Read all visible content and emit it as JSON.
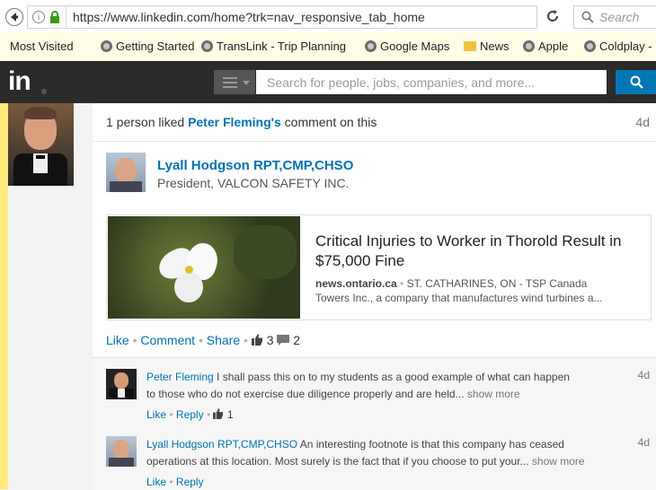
{
  "browser": {
    "url": "https://www.linkedin.com/home?trk=nav_responsive_tab_home",
    "search_placeholder": "Search",
    "bookmarks": [
      "Most Visited",
      "Getting Started",
      "TransLink - Trip Planning",
      "Google Maps",
      "News",
      "Apple",
      "Coldplay -"
    ]
  },
  "linkedin": {
    "logo": "in",
    "search_placeholder": "Search for people, jobs, companies, and more..."
  },
  "feed": {
    "activity_text_pre": "1 person liked",
    "activity_person": "Peter Fleming's",
    "activity_text_post": "comment on this",
    "activity_time": "4d",
    "author_name": "Lyall Hodgson RPT,CMP,CHSO",
    "author_title": "President, VALCON SAFETY INC.",
    "article": {
      "title": "Critical Injuries to Worker in Thorold Result in $75,000 Fine",
      "source": "news.ontario.ca",
      "snippet_line1": "ST. CATHARINES, ON - TSP Canada",
      "snippet_line2": "Towers Inc., a company that manufactures wind turbines a..."
    },
    "actions": {
      "like": "Like",
      "comment": "Comment",
      "share": "Share",
      "likes": "3",
      "comments": "2"
    },
    "comments": [
      {
        "name": "Peter Fleming",
        "line1": "I shall pass this on to my students as a good example of what can happen",
        "line2": "to those who do not exercise due diligence properly and are held...",
        "show_more": "show more",
        "time": "4d",
        "like": "Like",
        "reply": "Reply",
        "likes": "1"
      },
      {
        "name": "Lyall Hodgson RPT,CMP,CHSO",
        "line1": "An interesting footnote is that this company has ceased",
        "line2": "operations at this location. Most surely is the fact that if you choose to put your...",
        "show_more": "show more",
        "time": "4d",
        "like": "Like",
        "reply": "Reply"
      }
    ]
  }
}
